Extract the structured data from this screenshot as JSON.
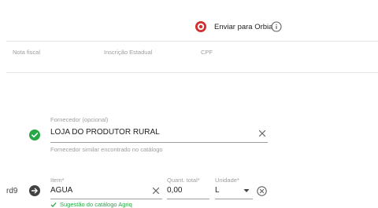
{
  "header": {
    "send_button_label": "Enviar para Orbia",
    "brand_color": "#d32f2f"
  },
  "columns": [
    "Nota fiscal",
    "Inscrição Estadual",
    "CPF"
  ],
  "supplier": {
    "label": "Fornecedor (opcional)",
    "value": "LOJA DO PRODUTOR RURAL",
    "helper": "Fornecedor similar encontrado no catálogo",
    "status_color": "#27a745"
  },
  "item_row": {
    "row_prefix": "rd9",
    "item_label": "Item*",
    "item_value": "AGUA",
    "quantity_label": "Quant. total*",
    "quantity_value": "0,00",
    "unit_label": "Unidade*",
    "unit_value": "L",
    "suggestion_text": "Sugestão do catálogo Agriq"
  }
}
